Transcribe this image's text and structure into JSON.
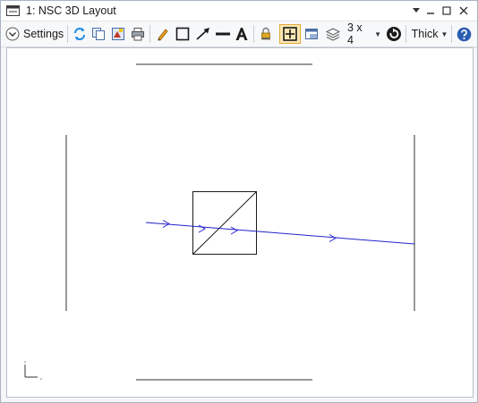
{
  "window": {
    "title": "1: NSC 3D Layout",
    "controls": [
      "chevron-down-icon",
      "minimize-icon",
      "restore-icon",
      "close-icon"
    ]
  },
  "toolbar": {
    "settings_label": "Settings",
    "grid_label": "3 x 4",
    "line_weight_label": "Thick"
  },
  "layout": {
    "axis_labels": [
      "x",
      "z"
    ],
    "colors": {
      "ray": "#2222cc",
      "geometry": "#333333",
      "toolbar_selected": "#fbe7b3"
    }
  }
}
